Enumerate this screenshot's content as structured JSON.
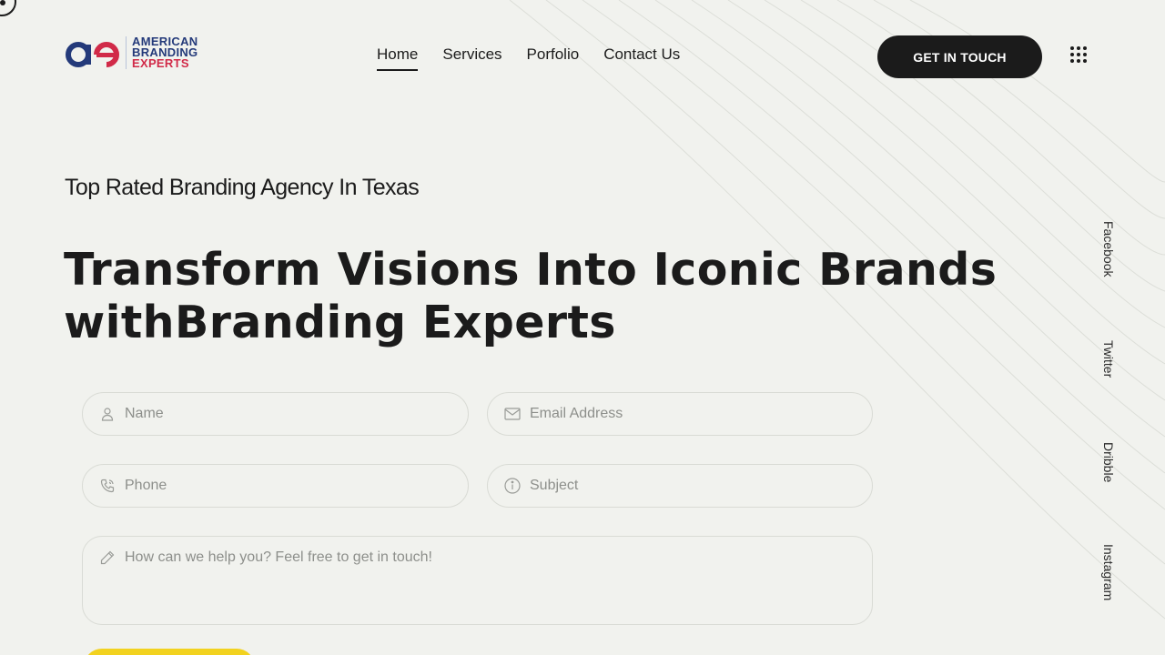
{
  "brand": {
    "logo_lines": [
      "AMERICAN",
      "BRANDING",
      "EXPERTS"
    ],
    "colors": {
      "navy": "#243a7a",
      "red": "#d12a48"
    }
  },
  "nav": {
    "items": [
      {
        "label": "Home",
        "active": true
      },
      {
        "label": "Services",
        "active": false
      },
      {
        "label": "Porfolio",
        "active": false
      },
      {
        "label": "Contact Us",
        "active": false
      }
    ]
  },
  "header": {
    "cta_label": "GET IN TOUCH",
    "menu_icon": "grid-dots-icon"
  },
  "hero": {
    "eyebrow": "Top Rated Branding Agency In Texas",
    "headline_line1": "Transform Visions Into Iconic Brands",
    "headline_line2": "withBranding Experts"
  },
  "social": [
    "Facebook",
    "Twitter",
    "Dribble",
    "Instagram"
  ],
  "form": {
    "name_placeholder": "Name",
    "email_placeholder": "Email Address",
    "phone_placeholder": "Phone",
    "subject_placeholder": "Subject",
    "message_placeholder": "How can we help you? Feel free to get in touch!",
    "icons": [
      "user-icon",
      "envelope-icon",
      "phone-icon",
      "info-icon",
      "pencil-icon"
    ],
    "submit_color": "#f2d21f"
  },
  "theme": {
    "background": "#f1f2ee",
    "text": "#1b1b1b",
    "cta_bg": "#1b1b1b"
  }
}
